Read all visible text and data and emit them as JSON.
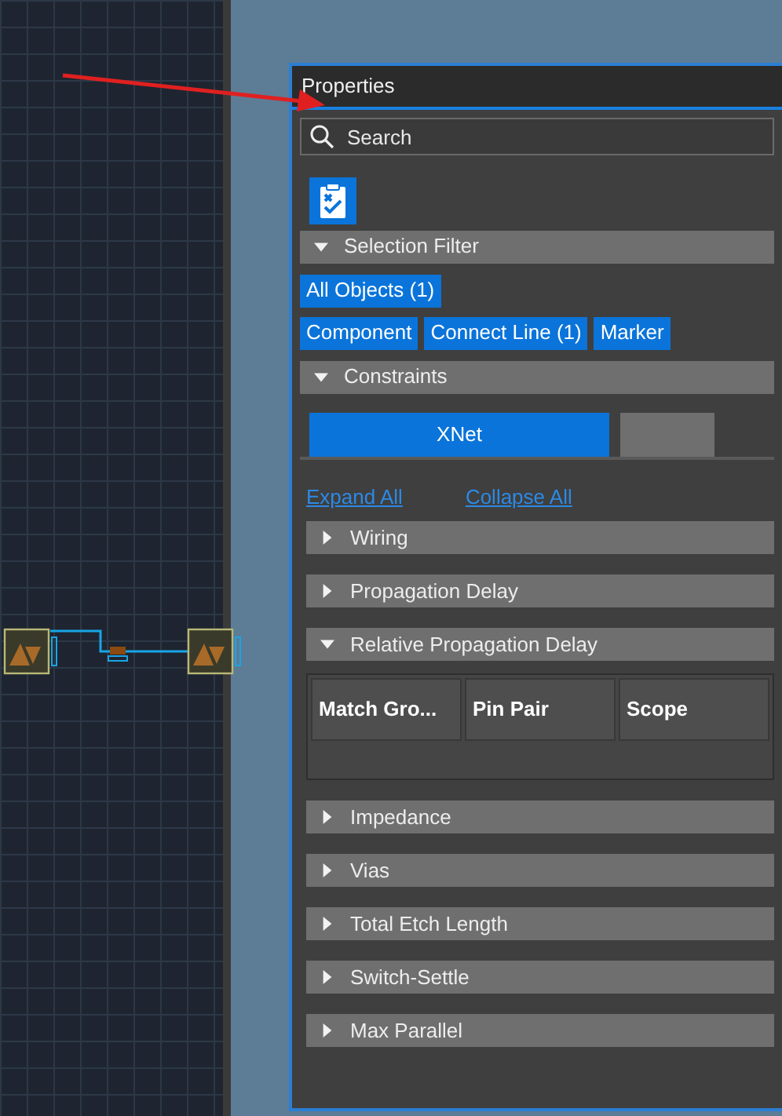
{
  "panel": {
    "title": "Properties",
    "search": {
      "placeholder": "Search"
    },
    "selection_filter": {
      "title": "Selection Filter",
      "expanded": true,
      "chips": [
        {
          "label": "All Objects (1)",
          "selected": true
        },
        {
          "label": "Component",
          "selected": true
        },
        {
          "label": "Connect Line (1)",
          "selected": true
        },
        {
          "label": "Marker",
          "selected": true
        }
      ]
    },
    "constraints": {
      "title": "Constraints",
      "expanded": true,
      "tabs": [
        {
          "label": "XNet",
          "selected": true
        },
        {
          "selected": false
        }
      ],
      "links": [
        "Expand All",
        "Collapse All"
      ],
      "groups": [
        {
          "title": "Wiring",
          "expanded": false
        },
        {
          "title": "Propagation Delay",
          "expanded": false
        },
        {
          "title": "Relative Propagation Delay",
          "expanded": true,
          "columns": [
            "Match Gro...",
            "Pin Pair",
            "Scope"
          ]
        },
        {
          "title": "Impedance",
          "expanded": false
        },
        {
          "title": "Vias",
          "expanded": false
        },
        {
          "title": "Total Etch Length",
          "expanded": false
        },
        {
          "title": "Switch-Settle",
          "expanded": false
        },
        {
          "title": "Max Parallel",
          "expanded": false
        }
      ]
    }
  }
}
